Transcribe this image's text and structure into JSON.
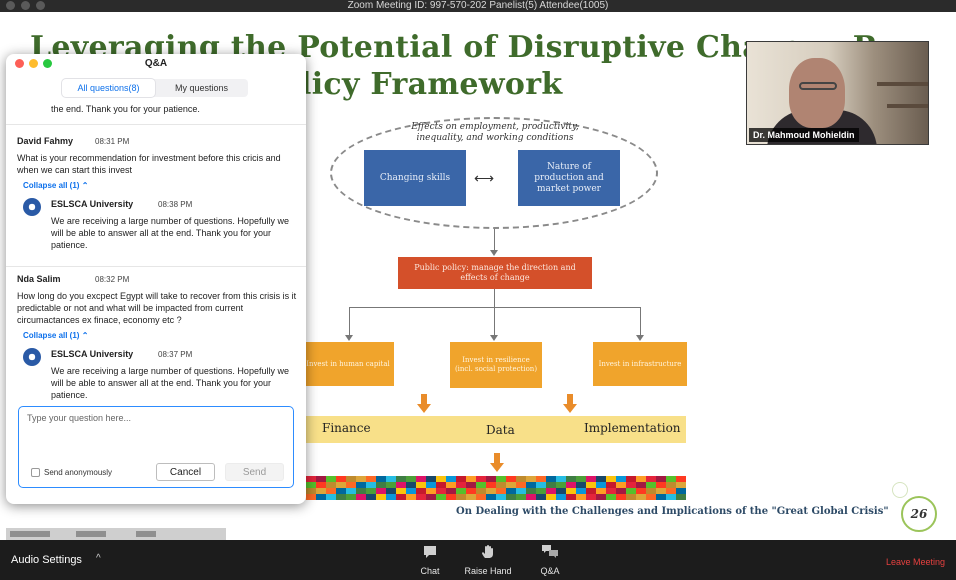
{
  "window": {
    "title": "Zoom Meeting ID: 997-570-202   Panelist(5)   Attendee(1005)"
  },
  "slide": {
    "title_line1": "Leveraging the Potential of Disruptive Changes R",
    "title_line2": "licy Framework",
    "effects_label": "Effects on employment, productivity, inequality, and working conditions",
    "box_changing_skills": "Changing skills",
    "box_nature": "Nature of production and market power",
    "double_arrow": "⟷",
    "public_policy": "Public policy: manage the direction and effects of change",
    "invest_capital": "Invest in human capital",
    "invest_resilience": "Invest in resilience (incl. social protection)",
    "invest_infra": "Invest in infrastructure",
    "band_finance": "Finance",
    "band_data": "Data",
    "band_implementation": "Implementation",
    "footer": "On Dealing with the Challenges and Implications of the \"Great Global Crisis\"",
    "page_number": "26"
  },
  "video": {
    "name": "Dr. Mahmoud Mohieldin"
  },
  "qa": {
    "title": "Q&A",
    "tabs": [
      "All questions(8)",
      "My questions"
    ],
    "partial_text": "the end. Thank you for your patience.",
    "questions": [
      {
        "name": "David Fahmy",
        "time": "08:31 PM",
        "text": "What is your recommendation for investment before this cricis and when we can start this invest",
        "collapse": "Collapse all (1)",
        "answer": {
          "name": "ESLSCA University",
          "time": "08:38 PM",
          "text": "We are receiving a large number of questions. Hopefully we will be able to answer all at the end. Thank you for your patience."
        }
      },
      {
        "name": "Nda Salim",
        "time": "08:32 PM",
        "text": "How long do you excpect Egypt will take to recover from this crisis is it predictable or not and what will be impacted from current circumactances ex finace, economy etc ?",
        "collapse": "Collapse all (1)",
        "answer": {
          "name": "ESLSCA University",
          "time": "08:37 PM",
          "text": "We are receiving a large number of questions. Hopefully we will be able to answer all at the end. Thank you for your patience."
        }
      }
    ],
    "input_placeholder": "Type your question here...",
    "send_anonymously": "Send anonymously",
    "cancel_label": "Cancel",
    "send_label": "Send"
  },
  "toolbar": {
    "audio_settings": "Audio Settings",
    "audio_caret": "^",
    "chat": "Chat",
    "raise_hand": "Raise Hand",
    "qa": "Q&A",
    "leave": "Leave Meeting"
  },
  "icons": {
    "chat": "chat-bubble-icon",
    "raise_hand": "hand-icon",
    "qa": "qa-bubbles-icon",
    "logo": "eslsca-logo-icon"
  },
  "colors": {
    "accent_blue": "#0e71eb",
    "slide_title_green": "#3f6b2b",
    "box_blue": "#3a66a8",
    "policy_red": "#d4502a",
    "invest_orange": "#f0a42c",
    "band_yellow": "#f8e089",
    "leave_red": "#e5403f"
  }
}
